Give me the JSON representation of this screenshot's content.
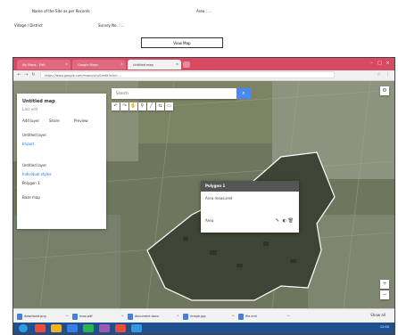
{
  "document": {
    "line1_left": "Name of the Site as per Records",
    "line1_right": "Area : ...",
    "line2_left": "Village / District",
    "line2_mid": "Survey No. : ...",
    "button_label": "View Map"
  },
  "browser": {
    "tabs": [
      {
        "label": "My Maps - Edit"
      },
      {
        "label": "Google Maps"
      },
      {
        "label": "Untitled map"
      }
    ],
    "url": "https://www.google.com/maps/d/u/0/edit?mid=..."
  },
  "map_panel": {
    "title": "Untitled map",
    "subtitle": "Last edit",
    "actions": [
      "Add layer",
      "Share",
      "Preview"
    ],
    "layer1_name": "Untitled layer",
    "layer1_item": "Import",
    "layer2_name": "Untitled layer",
    "layer2_style": "Individual styles",
    "layer2_item": "Polygon 1",
    "basemap_label": "Base map"
  },
  "search": {
    "placeholder": "Search"
  },
  "popup": {
    "title": "Polygon 1",
    "desc": "Area measured",
    "meta": "Area",
    "actions": [
      "edit",
      "style",
      "delete"
    ]
  },
  "downloads": [
    {
      "name": "download.png"
    },
    {
      "name": "map.pdf"
    },
    {
      "name": "document.docx"
    },
    {
      "name": "image.jpg"
    },
    {
      "name": "file.kml"
    }
  ],
  "downloads_show_all": "Show all",
  "taskbar": {
    "apps": [
      "#e94f3a",
      "#f6b21b",
      "#3b7de0",
      "#2bb24c",
      "#9b59b6",
      "#e74c3c",
      "#3498db"
    ],
    "tray_time": "12:00"
  },
  "colors": {
    "tab_strip": "#d84a62",
    "taskbar": "#1f4f8c",
    "accent": "#4a89f3"
  }
}
